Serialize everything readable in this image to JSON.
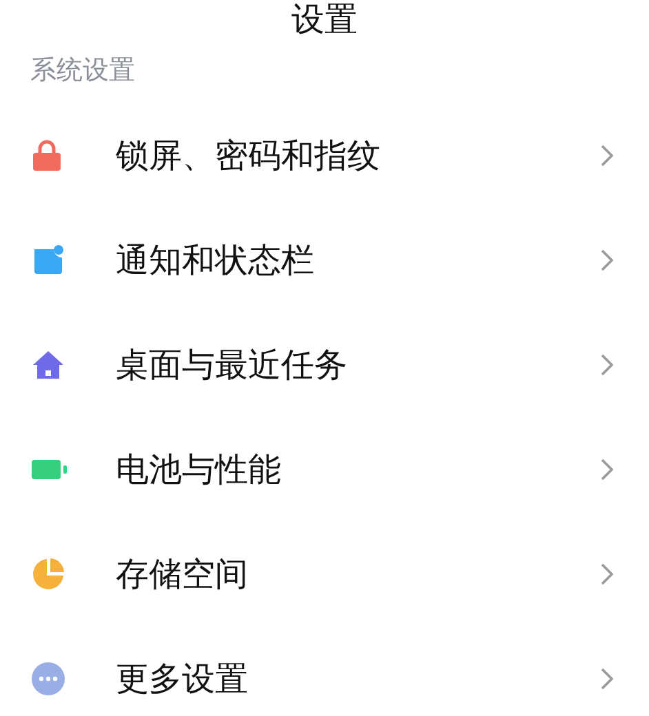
{
  "title": "设置",
  "section": {
    "label": "系统设置"
  },
  "items": [
    {
      "label": "锁屏、密码和指纹",
      "kind": "lock"
    },
    {
      "label": "通知和状态栏",
      "kind": "notification"
    },
    {
      "label": "桌面与最近任务",
      "kind": "home"
    },
    {
      "label": "电池与性能",
      "kind": "battery"
    },
    {
      "label": "存储空间",
      "kind": "storage"
    },
    {
      "label": "更多设置",
      "kind": "more"
    }
  ]
}
